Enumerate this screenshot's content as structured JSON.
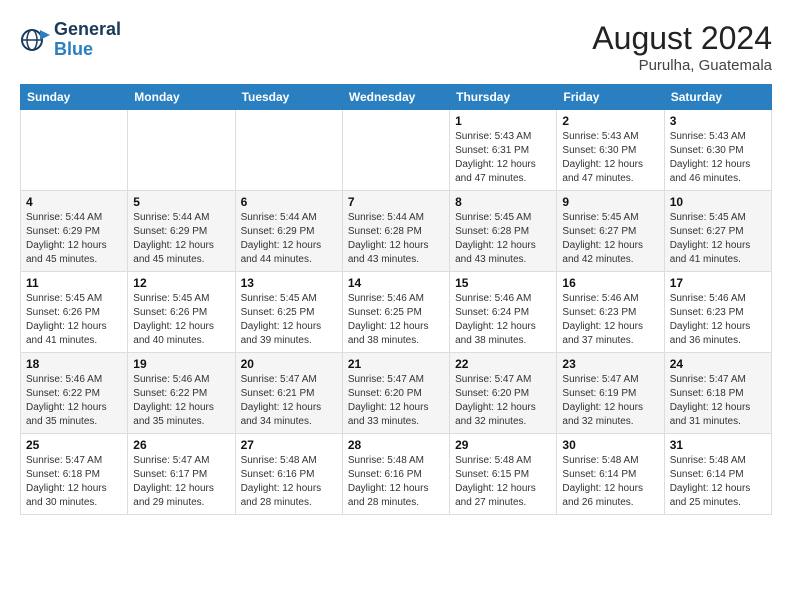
{
  "header": {
    "logo": {
      "line1": "General",
      "line2": "Blue"
    },
    "title": "August 2024",
    "location": "Purulha, Guatemala"
  },
  "weekdays": [
    "Sunday",
    "Monday",
    "Tuesday",
    "Wednesday",
    "Thursday",
    "Friday",
    "Saturday"
  ],
  "weeks": [
    [
      {
        "day": "",
        "info": ""
      },
      {
        "day": "",
        "info": ""
      },
      {
        "day": "",
        "info": ""
      },
      {
        "day": "",
        "info": ""
      },
      {
        "day": "1",
        "info": "Sunrise: 5:43 AM\nSunset: 6:31 PM\nDaylight: 12 hours\nand 47 minutes."
      },
      {
        "day": "2",
        "info": "Sunrise: 5:43 AM\nSunset: 6:30 PM\nDaylight: 12 hours\nand 47 minutes."
      },
      {
        "day": "3",
        "info": "Sunrise: 5:43 AM\nSunset: 6:30 PM\nDaylight: 12 hours\nand 46 minutes."
      }
    ],
    [
      {
        "day": "4",
        "info": "Sunrise: 5:44 AM\nSunset: 6:29 PM\nDaylight: 12 hours\nand 45 minutes."
      },
      {
        "day": "5",
        "info": "Sunrise: 5:44 AM\nSunset: 6:29 PM\nDaylight: 12 hours\nand 45 minutes."
      },
      {
        "day": "6",
        "info": "Sunrise: 5:44 AM\nSunset: 6:29 PM\nDaylight: 12 hours\nand 44 minutes."
      },
      {
        "day": "7",
        "info": "Sunrise: 5:44 AM\nSunset: 6:28 PM\nDaylight: 12 hours\nand 43 minutes."
      },
      {
        "day": "8",
        "info": "Sunrise: 5:45 AM\nSunset: 6:28 PM\nDaylight: 12 hours\nand 43 minutes."
      },
      {
        "day": "9",
        "info": "Sunrise: 5:45 AM\nSunset: 6:27 PM\nDaylight: 12 hours\nand 42 minutes."
      },
      {
        "day": "10",
        "info": "Sunrise: 5:45 AM\nSunset: 6:27 PM\nDaylight: 12 hours\nand 41 minutes."
      }
    ],
    [
      {
        "day": "11",
        "info": "Sunrise: 5:45 AM\nSunset: 6:26 PM\nDaylight: 12 hours\nand 41 minutes."
      },
      {
        "day": "12",
        "info": "Sunrise: 5:45 AM\nSunset: 6:26 PM\nDaylight: 12 hours\nand 40 minutes."
      },
      {
        "day": "13",
        "info": "Sunrise: 5:45 AM\nSunset: 6:25 PM\nDaylight: 12 hours\nand 39 minutes."
      },
      {
        "day": "14",
        "info": "Sunrise: 5:46 AM\nSunset: 6:25 PM\nDaylight: 12 hours\nand 38 minutes."
      },
      {
        "day": "15",
        "info": "Sunrise: 5:46 AM\nSunset: 6:24 PM\nDaylight: 12 hours\nand 38 minutes."
      },
      {
        "day": "16",
        "info": "Sunrise: 5:46 AM\nSunset: 6:23 PM\nDaylight: 12 hours\nand 37 minutes."
      },
      {
        "day": "17",
        "info": "Sunrise: 5:46 AM\nSunset: 6:23 PM\nDaylight: 12 hours\nand 36 minutes."
      }
    ],
    [
      {
        "day": "18",
        "info": "Sunrise: 5:46 AM\nSunset: 6:22 PM\nDaylight: 12 hours\nand 35 minutes."
      },
      {
        "day": "19",
        "info": "Sunrise: 5:46 AM\nSunset: 6:22 PM\nDaylight: 12 hours\nand 35 minutes."
      },
      {
        "day": "20",
        "info": "Sunrise: 5:47 AM\nSunset: 6:21 PM\nDaylight: 12 hours\nand 34 minutes."
      },
      {
        "day": "21",
        "info": "Sunrise: 5:47 AM\nSunset: 6:20 PM\nDaylight: 12 hours\nand 33 minutes."
      },
      {
        "day": "22",
        "info": "Sunrise: 5:47 AM\nSunset: 6:20 PM\nDaylight: 12 hours\nand 32 minutes."
      },
      {
        "day": "23",
        "info": "Sunrise: 5:47 AM\nSunset: 6:19 PM\nDaylight: 12 hours\nand 32 minutes."
      },
      {
        "day": "24",
        "info": "Sunrise: 5:47 AM\nSunset: 6:18 PM\nDaylight: 12 hours\nand 31 minutes."
      }
    ],
    [
      {
        "day": "25",
        "info": "Sunrise: 5:47 AM\nSunset: 6:18 PM\nDaylight: 12 hours\nand 30 minutes."
      },
      {
        "day": "26",
        "info": "Sunrise: 5:47 AM\nSunset: 6:17 PM\nDaylight: 12 hours\nand 29 minutes."
      },
      {
        "day": "27",
        "info": "Sunrise: 5:48 AM\nSunset: 6:16 PM\nDaylight: 12 hours\nand 28 minutes."
      },
      {
        "day": "28",
        "info": "Sunrise: 5:48 AM\nSunset: 6:16 PM\nDaylight: 12 hours\nand 28 minutes."
      },
      {
        "day": "29",
        "info": "Sunrise: 5:48 AM\nSunset: 6:15 PM\nDaylight: 12 hours\nand 27 minutes."
      },
      {
        "day": "30",
        "info": "Sunrise: 5:48 AM\nSunset: 6:14 PM\nDaylight: 12 hours\nand 26 minutes."
      },
      {
        "day": "31",
        "info": "Sunrise: 5:48 AM\nSunset: 6:14 PM\nDaylight: 12 hours\nand 25 minutes."
      }
    ]
  ]
}
